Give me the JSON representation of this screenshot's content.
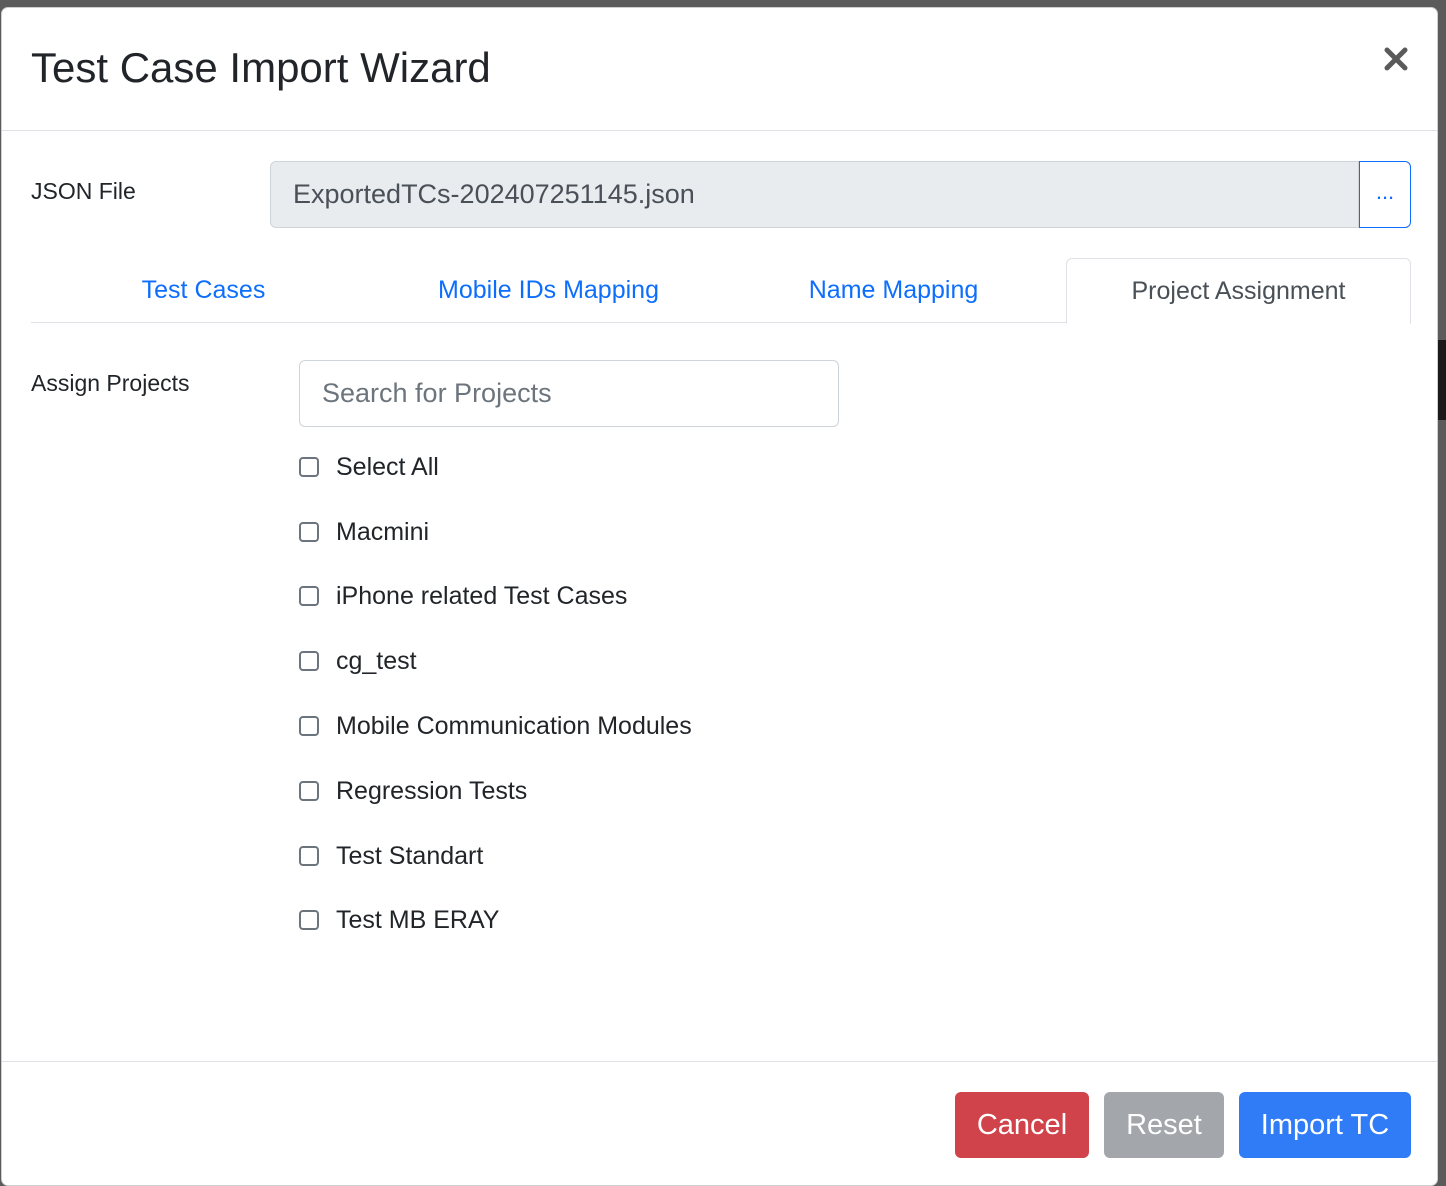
{
  "modal": {
    "title": "Test Case Import Wizard"
  },
  "json_file": {
    "label": "JSON File",
    "value": "ExportedTCs-202407251145.json",
    "browse_label": "..."
  },
  "tabs": [
    {
      "label": "Test Cases",
      "active": false
    },
    {
      "label": "Mobile IDs Mapping",
      "active": false
    },
    {
      "label": "Name Mapping",
      "active": false
    },
    {
      "label": "Project Assignment",
      "active": true
    }
  ],
  "assign": {
    "label": "Assign Projects",
    "search_placeholder": "Search for Projects",
    "items": [
      {
        "label": "Select All",
        "checked": false
      },
      {
        "label": "Macmini",
        "checked": false
      },
      {
        "label": "iPhone related Test Cases",
        "checked": false
      },
      {
        "label": "cg_test",
        "checked": false
      },
      {
        "label": "Mobile Communication Modules",
        "checked": false
      },
      {
        "label": "Regression Tests",
        "checked": false
      },
      {
        "label": "Test Standart",
        "checked": false
      },
      {
        "label": "Test MB ERAY",
        "checked": false
      }
    ]
  },
  "footer": {
    "cancel_label": "Cancel",
    "reset_label": "Reset",
    "import_label": "Import TC"
  },
  "colors": {
    "primary": "#0d6efd",
    "danger": "#d1434b",
    "secondary": "#a3a6aa"
  }
}
